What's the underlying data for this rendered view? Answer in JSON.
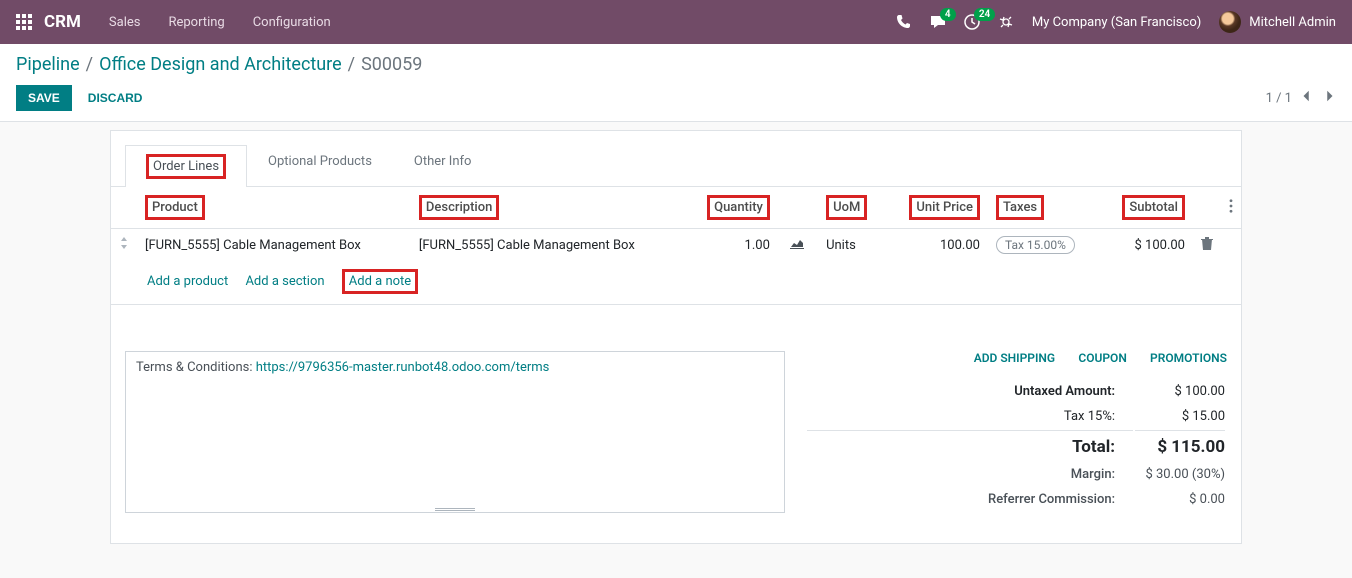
{
  "topbar": {
    "brand": "CRM",
    "links": [
      "Sales",
      "Reporting",
      "Configuration"
    ],
    "msg_badge": "4",
    "activity_badge": "24",
    "company": "My Company (San Francisco)",
    "user": "Mitchell Admin"
  },
  "breadcrumb": {
    "root": "Pipeline",
    "mid": "Office Design and Architecture",
    "current": "S00059"
  },
  "actions": {
    "save": "SAVE",
    "discard": "DISCARD"
  },
  "pager": {
    "text": "1 / 1"
  },
  "tabs": {
    "order_lines": "Order Lines",
    "optional": "Optional Products",
    "other": "Other Info"
  },
  "table": {
    "headers": {
      "product": "Product",
      "description": "Description",
      "quantity": "Quantity",
      "uom": "UoM",
      "unit_price": "Unit Price",
      "taxes": "Taxes",
      "subtotal": "Subtotal"
    },
    "row": {
      "product": "[FURN_5555] Cable Management Box",
      "description": "[FURN_5555] Cable Management Box",
      "quantity": "1.00",
      "uom": "Units",
      "unit_price": "100.00",
      "tax": "Tax 15.00%",
      "subtotal": "$ 100.00"
    },
    "add": {
      "product": "Add a product",
      "section": "Add a section",
      "note": "Add a note"
    }
  },
  "terms": {
    "prefix": "Terms & Conditions: ",
    "link": "https://9796356-master.runbot48.odoo.com/terms"
  },
  "totals": {
    "actions": {
      "shipping": "ADD SHIPPING",
      "coupon": "COUPON",
      "promotions": "PROMOTIONS"
    },
    "untaxed_label": "Untaxed Amount:",
    "untaxed": "$ 100.00",
    "tax_label": "Tax 15%:",
    "tax": "$ 15.00",
    "total_label": "Total:",
    "total": "$ 115.00",
    "margin_label": "Margin:",
    "margin": "$ 30.00 (30%)",
    "referrer_label": "Referrer Commission:",
    "referrer": "$ 0.00"
  }
}
